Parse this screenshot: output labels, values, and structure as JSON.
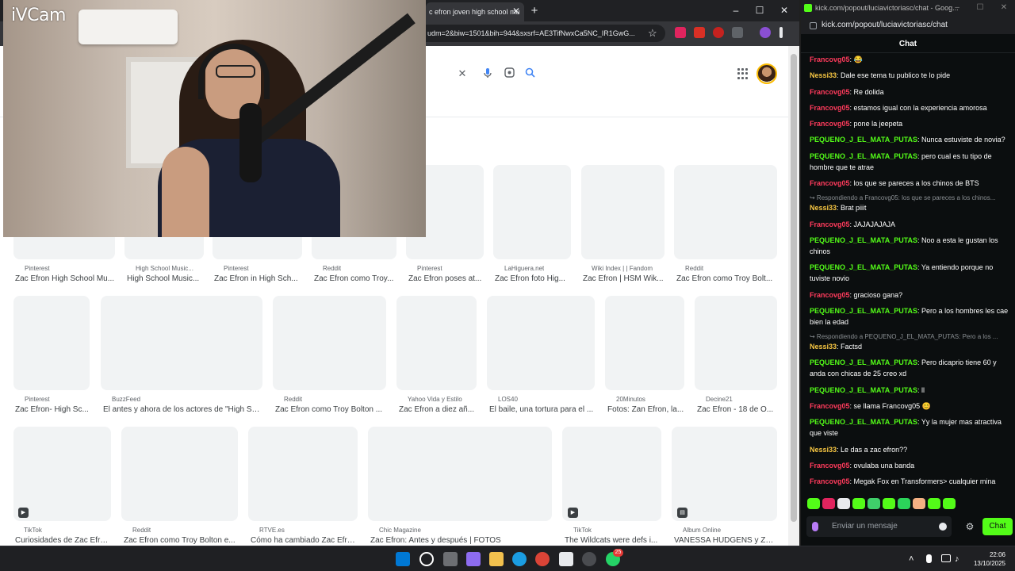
{
  "chrome": {
    "tab_title": "c efron joven high school mu",
    "tab_close": "✕",
    "new_tab": "+",
    "win_min": "–",
    "win_max": "☐",
    "win_close": "✕",
    "url": "udm=2&biw=1501&bih=944&sxsrf=AE3TifNwxCa5NC_IR1GwG...",
    "star": "☆",
    "search_clear": "✕"
  },
  "results": [
    [
      {
        "source": "Pinterest",
        "title": "Zac Efron High School Mu..."
      },
      {
        "source": "High School Music...",
        "title": "High School Music..."
      },
      {
        "source": "Pinterest",
        "title": "Zac Efron in High Sch..."
      },
      {
        "source": "Reddit",
        "title": "Zac Efron como Troy..."
      },
      {
        "source": "Pinterest",
        "title": "Zac Efron poses at..."
      },
      {
        "source": "LaHiguera.net",
        "title": "Zac Efron foto Hig..."
      },
      {
        "source": "Wiki Index | | Fandom",
        "title": "Zac Efron | HSM Wik..."
      },
      {
        "source": "Reddit",
        "title": "Zac Efron como Troy Bolt..."
      }
    ],
    [
      {
        "source": "Pinterest",
        "title": "Zac Efron- High Sc..."
      },
      {
        "source": "BuzzFeed",
        "title": "El antes y ahora de los actores de \"High Sc..."
      },
      {
        "source": "Reddit",
        "title": "Zac Efron como Troy Bolton ..."
      },
      {
        "source": "Yahoo Vida y Estilo",
        "title": "Zac Efron a diez añ..."
      },
      {
        "source": "LOS40",
        "title": "El baile, una tortura para el ..."
      },
      {
        "source": "20Minutos",
        "title": "Fotos: Zan Efron, la..."
      },
      {
        "source": "Decine21",
        "title": "Zac Efron - 18 de O..."
      }
    ],
    [
      {
        "source": "TikTok",
        "title": "Curiosidades de Zac Efro..."
      },
      {
        "source": "Reddit",
        "title": "Zac Efron como Troy Bolton e..."
      },
      {
        "source": "RTVE.es",
        "title": "Cómo ha cambiado Zac Efro..."
      },
      {
        "source": "Chic Magazine",
        "title": "Zac Efron: Antes y después | FOTOS"
      },
      {
        "source": "TikTok",
        "title": "The Wildcats were defs i..."
      },
      {
        "source": "Album Online",
        "title": "VANESSA HUDGENS y ZA..."
      }
    ]
  ],
  "cam": {
    "logo": "iVCam"
  },
  "kick": {
    "window_title": "kick.com/popout/luciavictoriasc/chat - Goog...",
    "url": "kick.com/popout/luciavictoriasc/chat",
    "header": "Chat",
    "colors": {
      "francovg": "#ff3b5c",
      "nessi": "#f5c542",
      "pequeno": "#53fc18",
      "text": "#ffffff",
      "reply": "#8a8f93",
      "accent": "#53fc18"
    },
    "messages": [
      {
        "user": "Francovg05",
        "color": "#ff3b5c",
        "text": " 😂"
      },
      {
        "user": "Nessi33",
        "color": "#f5c542",
        "text": "Dale ese tema tu publico te lo pide"
      },
      {
        "user": "Francovg05",
        "color": "#ff3b5c",
        "text": "Re dolida"
      },
      {
        "user": "Francovg05",
        "color": "#ff3b5c",
        "text": "estamos igual con la experiencia amorosa"
      },
      {
        "user": "Francovg05",
        "color": "#ff3b5c",
        "text": "pone la jeepeta"
      },
      {
        "user": "PEQUENO_J_EL_MATA_PUTAS",
        "color": "#53fc18",
        "text": "Nunca estuviste de novia?"
      },
      {
        "user": "PEQUENO_J_EL_MATA_PUTAS",
        "color": "#53fc18",
        "text": "pero cual es tu tipo de hombre que te atrae"
      },
      {
        "user": "Francovg05",
        "color": "#ff3b5c",
        "text": "los que se pareces a los chinos de BTS"
      },
      {
        "reply": "↪ Respondiendo a Francovg05: los que se pareces a los chinos...",
        "user": "Nessi33",
        "color": "#f5c542",
        "text": "Brat piiit"
      },
      {
        "user": "Francovg05",
        "color": "#ff3b5c",
        "text": "JAJAJAJAJA"
      },
      {
        "user": "PEQUENO_J_EL_MATA_PUTAS",
        "color": "#53fc18",
        "text": "Noo a esta le gustan los chinos"
      },
      {
        "user": "PEQUENO_J_EL_MATA_PUTAS",
        "color": "#53fc18",
        "text": "Ya entiendo porque no tuviste novio"
      },
      {
        "user": "Francovg05",
        "color": "#ff3b5c",
        "text": "gracioso gana?"
      },
      {
        "user": "PEQUENO_J_EL_MATA_PUTAS",
        "color": "#53fc18",
        "text": "Pero a los hombres les cae bien la edad"
      },
      {
        "reply": "↪ Respondiendo a PEQUENO_J_EL_MATA_PUTAS: Pero a los ...",
        "user": "Nessi33",
        "color": "#f5c542",
        "text": "Factsd"
      },
      {
        "user": "PEQUENO_J_EL_MATA_PUTAS",
        "color": "#53fc18",
        "text": "Pero dicaprio tiene 60 y anda con chicas de 25 creo xd"
      },
      {
        "user": "PEQUENO_J_EL_MATA_PUTAS",
        "color": "#53fc18",
        "text": "ll"
      },
      {
        "user": "Francovg05",
        "color": "#ff3b5c",
        "text": "se llama Francovg05 😊"
      },
      {
        "user": "PEQUENO_J_EL_MATA_PUTAS",
        "color": "#53fc18",
        "text": "Yy la mujer mas atractiva que viste"
      },
      {
        "user": "Nessi33",
        "color": "#f5c542",
        "text": "Le das a zac efron??"
      },
      {
        "user": "Francovg05",
        "color": "#ff3b5c",
        "text": "ovulaba una banda"
      },
      {
        "user": "Francovg05",
        "color": "#ff3b5c",
        "text": "Megak Fox en Transformers> cualquier mina"
      }
    ],
    "input_placeholder": "Enviar un mensaje",
    "send_label": "Chat",
    "settings": "⚙"
  },
  "taskbar": {
    "time": "22:06",
    "date": "13/10/2025",
    "badge": "25"
  }
}
